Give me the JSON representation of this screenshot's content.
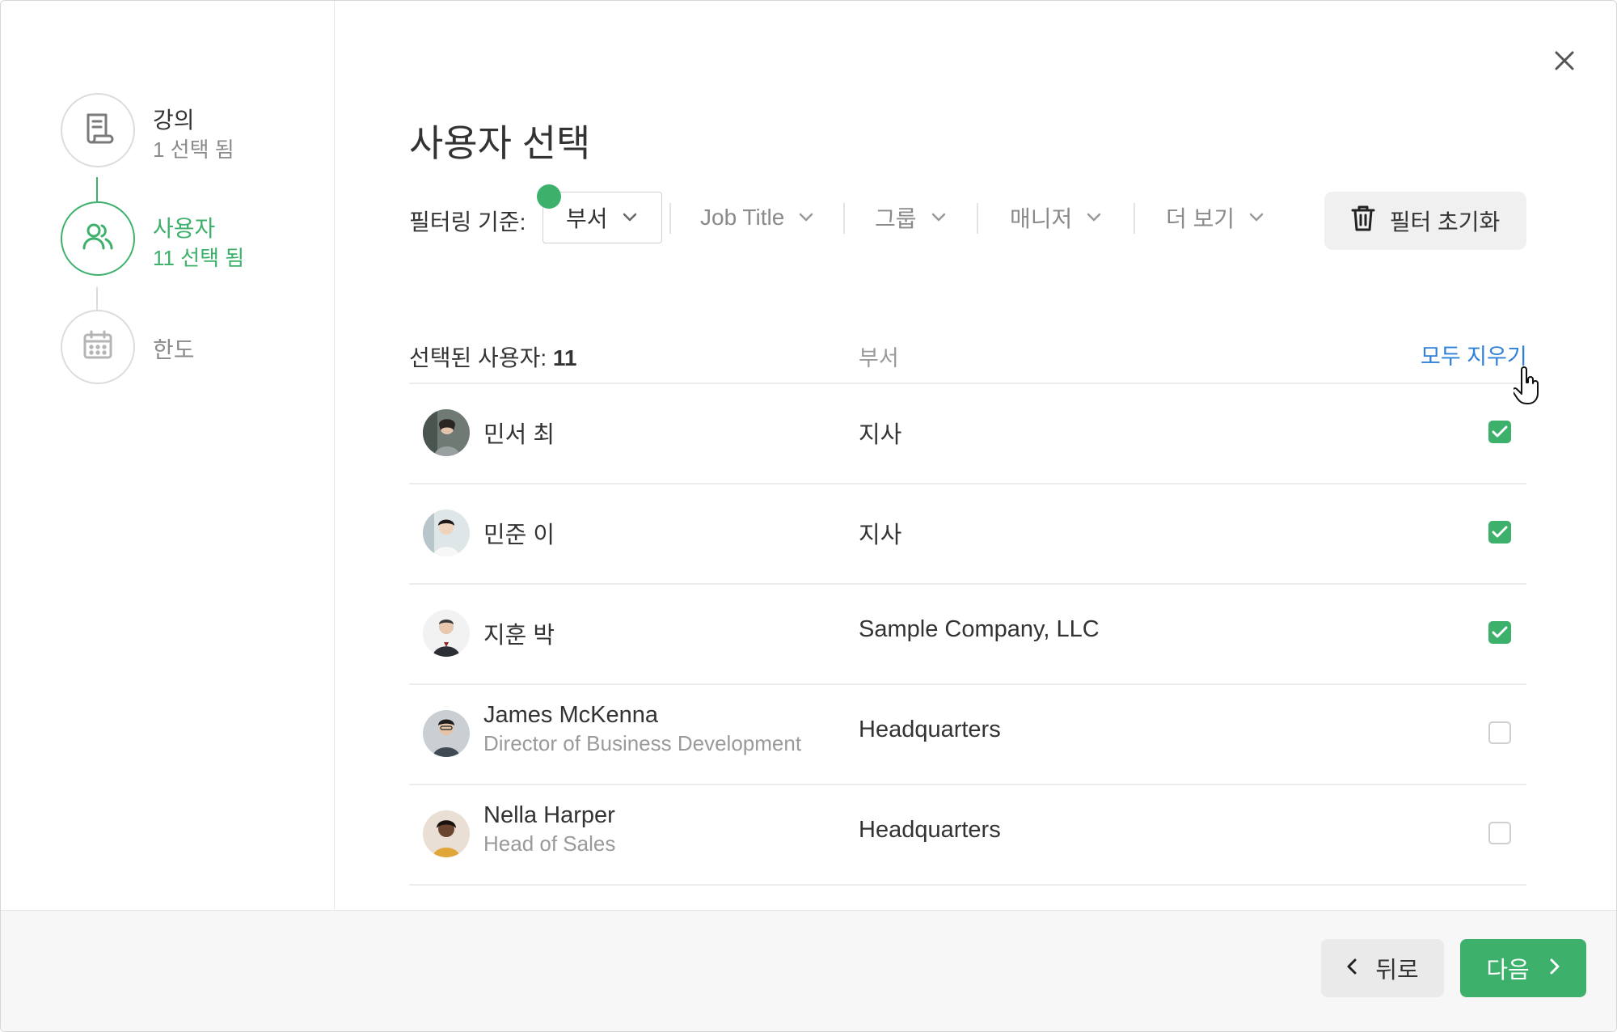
{
  "colors": {
    "accent": "#3db16b",
    "link": "#2f80d9",
    "muted": "#8a8a8a"
  },
  "steps": [
    {
      "title": "강의",
      "subtitle": "1 선택 됨",
      "icon": "document-icon",
      "state": "done"
    },
    {
      "title": "사용자",
      "subtitle": "11 선택 됨",
      "icon": "users-icon",
      "state": "active"
    },
    {
      "title": "한도",
      "subtitle": "",
      "icon": "calendar-icon",
      "state": "pending"
    }
  ],
  "page_title": "사용자 선택",
  "filters": {
    "label": "필터링 기준:",
    "items": [
      {
        "label": "부서",
        "selected": true
      },
      {
        "label": "Job Title",
        "selected": false
      },
      {
        "label": "그룹",
        "selected": false
      },
      {
        "label": "매니저",
        "selected": false
      },
      {
        "label": "더 보기",
        "selected": false
      }
    ],
    "reset_label": "필터 초기화"
  },
  "selection": {
    "label": "선택된 사용자:",
    "count": "11",
    "dept_header": "부서",
    "clear_all": "모두 지우기"
  },
  "users": [
    {
      "name": "민서 최",
      "title": "",
      "dept": "지사",
      "checked": true
    },
    {
      "name": "민준 이",
      "title": "",
      "dept": "지사",
      "checked": true
    },
    {
      "name": "지훈 박",
      "title": "",
      "dept": "Sample Company, LLC",
      "checked": true
    },
    {
      "name": "James McKenna",
      "title": "Director of Business Development",
      "dept": "Headquarters",
      "checked": false
    },
    {
      "name": "Nella Harper",
      "title": "Head of Sales",
      "dept": "Headquarters",
      "checked": false
    }
  ],
  "footer": {
    "back_label": "뒤로",
    "next_label": "다음"
  }
}
